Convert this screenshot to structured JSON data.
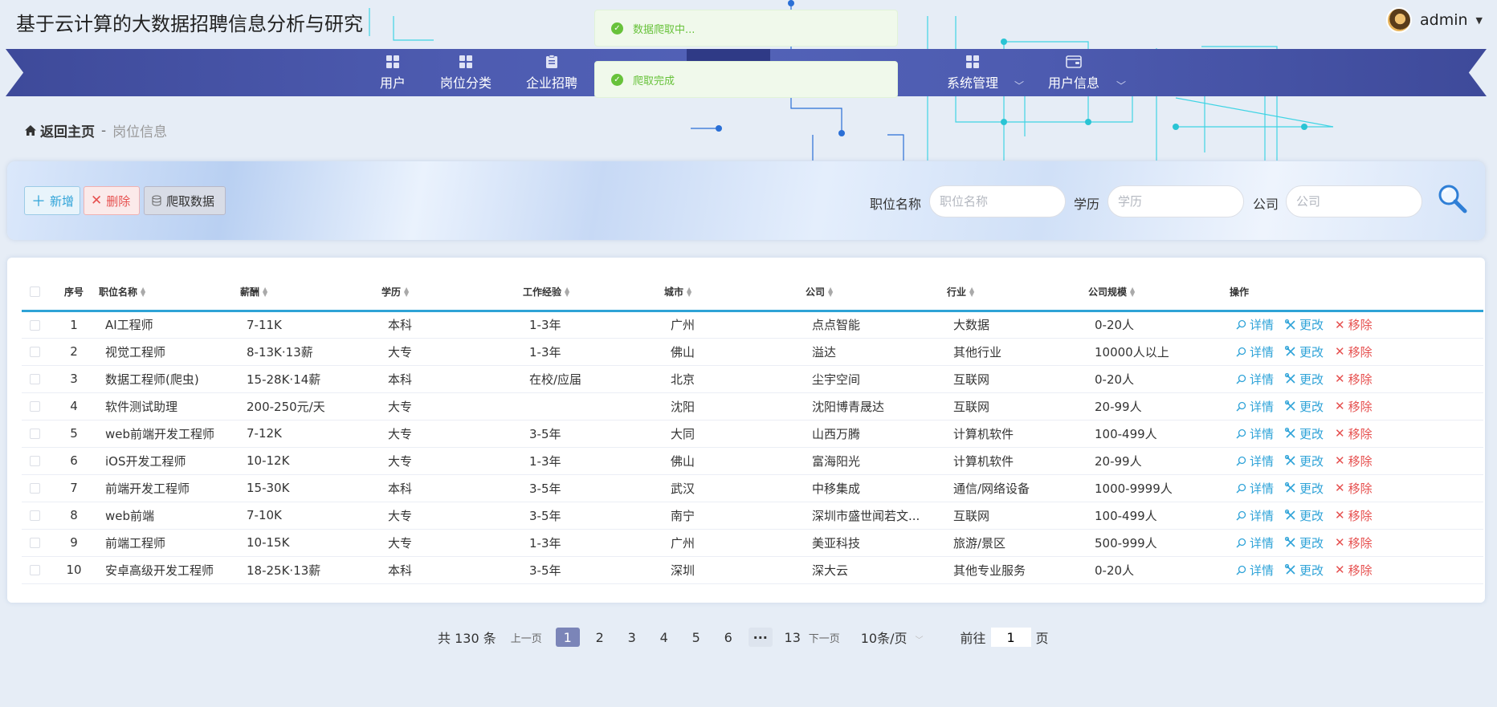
{
  "site": {
    "title": "基于云计算的大数据招聘信息分析与研究"
  },
  "user": {
    "name": "admin"
  },
  "nav": {
    "items": [
      {
        "label": "用户",
        "icon": "grid-icon"
      },
      {
        "label": "岗位分类",
        "icon": "grid-icon"
      },
      {
        "label": "企业招聘",
        "icon": "clipboard-icon"
      },
      {
        "label": "系统管理",
        "icon": "grid-icon"
      },
      {
        "label": "用户信息",
        "icon": "wallet-icon"
      }
    ]
  },
  "toasts": [
    {
      "text": "数据爬取中..."
    },
    {
      "text": "爬取完成"
    }
  ],
  "breadcrumb": {
    "home": "返回主页",
    "sep": "-",
    "current": "岗位信息"
  },
  "toolbar": {
    "add": "新增",
    "delete": "删除",
    "crawl": "爬取数据"
  },
  "filters": {
    "position": {
      "label": "职位名称",
      "placeholder": "职位名称",
      "value": ""
    },
    "education": {
      "label": "学历",
      "placeholder": "学历",
      "value": ""
    },
    "company": {
      "label": "公司",
      "placeholder": "公司",
      "value": ""
    }
  },
  "table": {
    "headers": {
      "index": "序号",
      "position": "职位名称",
      "salary": "薪酬",
      "education": "学历",
      "experience": "工作经验",
      "city": "城市",
      "company": "公司",
      "industry": "行业",
      "scale": "公司规模",
      "ops": "操作"
    },
    "ops": {
      "detail": "详情",
      "edit": "更改",
      "remove": "移除"
    },
    "rows": [
      {
        "idx": "1",
        "position": "AI工程师",
        "salary": "7-11K",
        "education": "本科",
        "experience": "1-3年",
        "city": "广州",
        "company": "点点智能",
        "industry": "大数据",
        "scale": "0-20人"
      },
      {
        "idx": "2",
        "position": "视觉工程师",
        "salary": "8-13K·13薪",
        "education": "大专",
        "experience": "1-3年",
        "city": "佛山",
        "company": "溢达",
        "industry": "其他行业",
        "scale": "10000人以上"
      },
      {
        "idx": "3",
        "position": "数据工程师(爬虫)",
        "salary": "15-28K·14薪",
        "education": "本科",
        "experience": "在校/应届",
        "city": "北京",
        "company": "尘宇空间",
        "industry": "互联网",
        "scale": "0-20人"
      },
      {
        "idx": "4",
        "position": "软件测试助理",
        "salary": "200-250元/天",
        "education": "大专",
        "experience": "",
        "city": "沈阳",
        "company": "沈阳博青晟达",
        "industry": "互联网",
        "scale": "20-99人"
      },
      {
        "idx": "5",
        "position": "web前端开发工程师",
        "salary": "7-12K",
        "education": "大专",
        "experience": "3-5年",
        "city": "大同",
        "company": "山西万腾",
        "industry": "计算机软件",
        "scale": "100-499人"
      },
      {
        "idx": "6",
        "position": "iOS开发工程师",
        "salary": "10-12K",
        "education": "大专",
        "experience": "1-3年",
        "city": "佛山",
        "company": "富海阳光",
        "industry": "计算机软件",
        "scale": "20-99人"
      },
      {
        "idx": "7",
        "position": "前端开发工程师",
        "salary": "15-30K",
        "education": "本科",
        "experience": "3-5年",
        "city": "武汉",
        "company": "中移集成",
        "industry": "通信/网络设备",
        "scale": "1000-9999人"
      },
      {
        "idx": "8",
        "position": "web前端",
        "salary": "7-10K",
        "education": "大专",
        "experience": "3-5年",
        "city": "南宁",
        "company": "深圳市盛世闻若文...",
        "industry": "互联网",
        "scale": "100-499人"
      },
      {
        "idx": "9",
        "position": "前端工程师",
        "salary": "10-15K",
        "education": "大专",
        "experience": "1-3年",
        "city": "广州",
        "company": "美亚科技",
        "industry": "旅游/景区",
        "scale": "500-999人"
      },
      {
        "idx": "10",
        "position": "安卓高级开发工程师",
        "salary": "18-25K·13薪",
        "education": "本科",
        "experience": "3-5年",
        "city": "深圳",
        "company": "深大云",
        "industry": "其他专业服务",
        "scale": "0-20人"
      }
    ]
  },
  "pagination": {
    "total": "共 130 条",
    "prev": "上一页",
    "pages": [
      "1",
      "2",
      "3",
      "4",
      "5",
      "6"
    ],
    "more": "···",
    "last": "13",
    "next": "下一页",
    "page_size": "10条/页",
    "goto_label": "前往",
    "goto_value": "1",
    "goto_suffix": "页"
  },
  "colors": {
    "nav": "#4d5bb0",
    "accent": "#2fa3d8",
    "danger": "#e6504f",
    "success": "#67c23a",
    "page_active": "#7b85b8"
  }
}
